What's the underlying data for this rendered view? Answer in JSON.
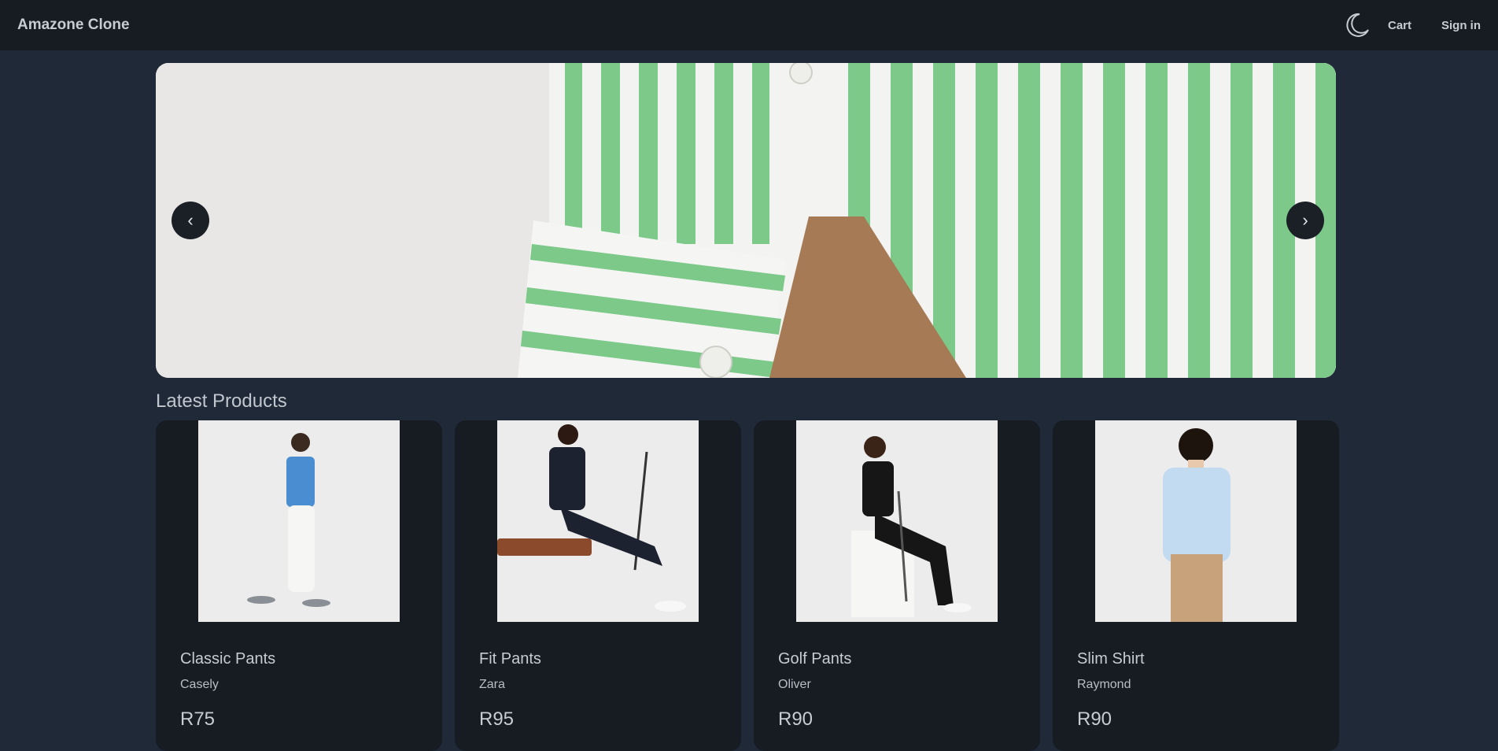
{
  "header": {
    "brand": "Amazone Clone",
    "theme_icon": "moon-icon",
    "cart_label": "Cart",
    "signin_label": "Sign in"
  },
  "carousel": {
    "prev_label": "‹",
    "next_label": "›",
    "image": "green-white-striped-shirt"
  },
  "section_title": "Latest Products",
  "products": [
    {
      "name": "Classic Pants",
      "brand": "Casely",
      "price": "R75",
      "image": "man-walking-blue-tshirt-white-pants"
    },
    {
      "name": "Fit Pants",
      "brand": "Zara",
      "price": "R95",
      "image": "man-sitting-bench-navy-polo"
    },
    {
      "name": "Golf Pants",
      "brand": "Oliver",
      "price": "R90",
      "image": "man-sitting-golf-club-black-outfit"
    },
    {
      "name": "Slim Shirt",
      "brand": "Raymond",
      "price": "R90",
      "image": "man-light-blue-shirt-khaki-pants"
    }
  ],
  "colors": {
    "background": "#1f2937",
    "navbar": "#171c23",
    "card": "#171c23",
    "stripe_green": "#7cc98a"
  }
}
